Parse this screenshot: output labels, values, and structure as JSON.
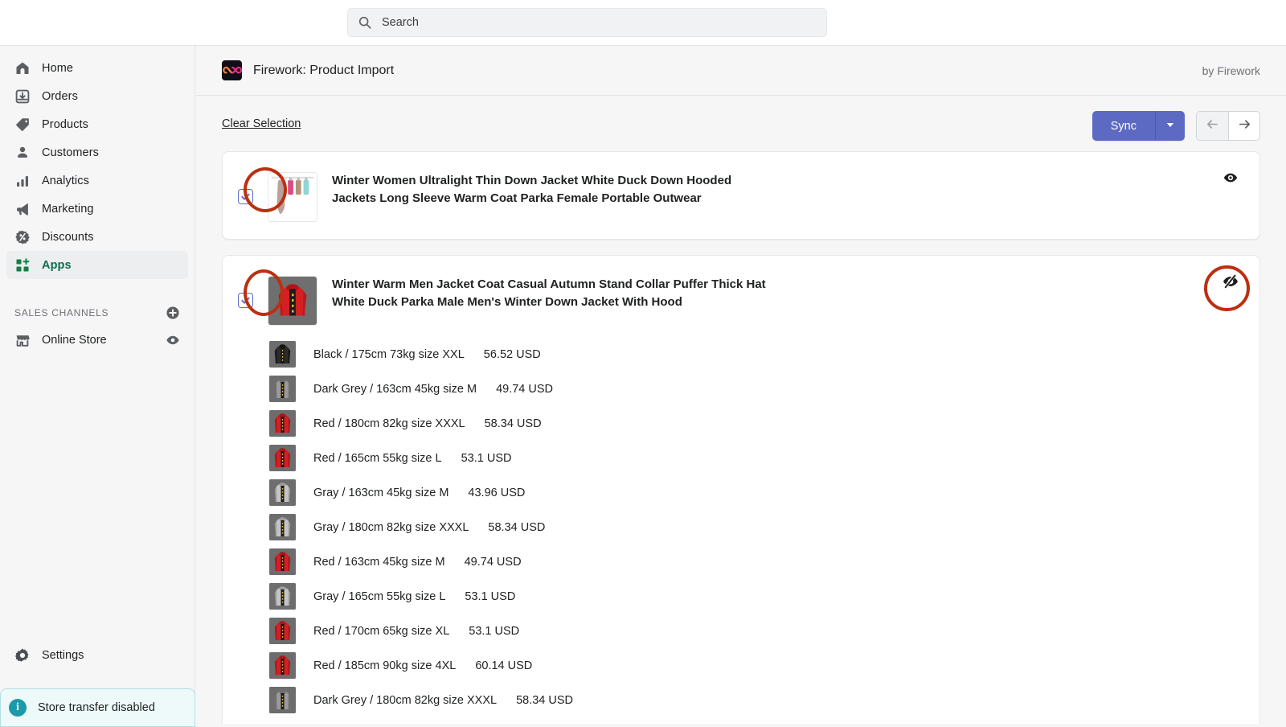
{
  "search": {
    "placeholder": "Search",
    "icon": "search-icon"
  },
  "sidebar": {
    "items": [
      {
        "label": "Home",
        "icon": "home-icon"
      },
      {
        "label": "Orders",
        "icon": "orders-inbox-icon"
      },
      {
        "label": "Products",
        "icon": "product-tag-icon"
      },
      {
        "label": "Customers",
        "icon": "person-icon"
      },
      {
        "label": "Analytics",
        "icon": "bar-chart-icon"
      },
      {
        "label": "Marketing",
        "icon": "megaphone-icon"
      },
      {
        "label": "Discounts",
        "icon": "discount-percent-icon"
      },
      {
        "label": "Apps",
        "icon": "apps-grid-plus-icon"
      }
    ],
    "active_item": "Apps",
    "sales_channels": {
      "title": "SALES CHANNELS",
      "add_icon": "circle-plus-icon",
      "channels": [
        {
          "label": "Online Store",
          "icon": "storefront-icon",
          "trailing_icon": "eye-icon"
        }
      ]
    },
    "settings": {
      "label": "Settings",
      "icon": "gear-icon"
    },
    "store_banner": {
      "label": "Store transfer disabled",
      "icon": "info-icon",
      "accent": "#1b9aaa",
      "background": "#eefafa"
    }
  },
  "app_header": {
    "title": "Firework: Product Import",
    "logo_icon": "firework-infinity-logo",
    "by_label": "by Firework"
  },
  "toolbar": {
    "clear_selection": "Clear Selection",
    "sync_label": "Sync",
    "sync_color": "#5c6ac4",
    "caret_icon": "chevron-down-icon",
    "prev_icon": "arrow-left-icon",
    "next_icon": "arrow-right-icon"
  },
  "annotation_color": "#bc2f10",
  "products": [
    {
      "checked": true,
      "title": "Winter Women Ultralight Thin Down Jacket White Duck Down Hooded Jackets Long Sleeve Warm Coat Parka Female Portable Outwear",
      "visibility_icon": "eye-icon",
      "visibility_state": "visible",
      "variants": []
    },
    {
      "checked": true,
      "title": "Winter Warm Men Jacket Coat Casual Autumn Stand Collar Puffer Thick Hat White Duck Parka Male Men's Winter Down Jacket With Hood",
      "visibility_icon": "eye-off-icon",
      "visibility_state": "hidden",
      "variants": [
        {
          "label": "Black / 175cm 73kg size XXL",
          "price": "56.52 USD",
          "color": "black"
        },
        {
          "label": "Dark Grey / 163cm 45kg size M",
          "price": "49.74 USD",
          "color": "darkgrey"
        },
        {
          "label": "Red / 180cm 82kg size XXXL",
          "price": "58.34 USD",
          "color": "red"
        },
        {
          "label": "Red / 165cm 55kg size L",
          "price": "53.1 USD",
          "color": "red"
        },
        {
          "label": "Gray / 163cm 45kg size M",
          "price": "43.96 USD",
          "color": "gray"
        },
        {
          "label": "Gray / 180cm 82kg size XXXL",
          "price": "58.34 USD",
          "color": "gray"
        },
        {
          "label": "Red / 163cm 45kg size M",
          "price": "49.74 USD",
          "color": "red"
        },
        {
          "label": "Gray / 165cm 55kg size L",
          "price": "53.1 USD",
          "color": "gray"
        },
        {
          "label": "Red / 170cm 65kg size XL",
          "price": "53.1 USD",
          "color": "red"
        },
        {
          "label": "Red / 185cm 90kg size 4XL",
          "price": "60.14 USD",
          "color": "red"
        },
        {
          "label": "Dark Grey / 180cm 82kg size XXXL",
          "price": "58.34 USD",
          "color": "darkgrey"
        }
      ]
    }
  ]
}
